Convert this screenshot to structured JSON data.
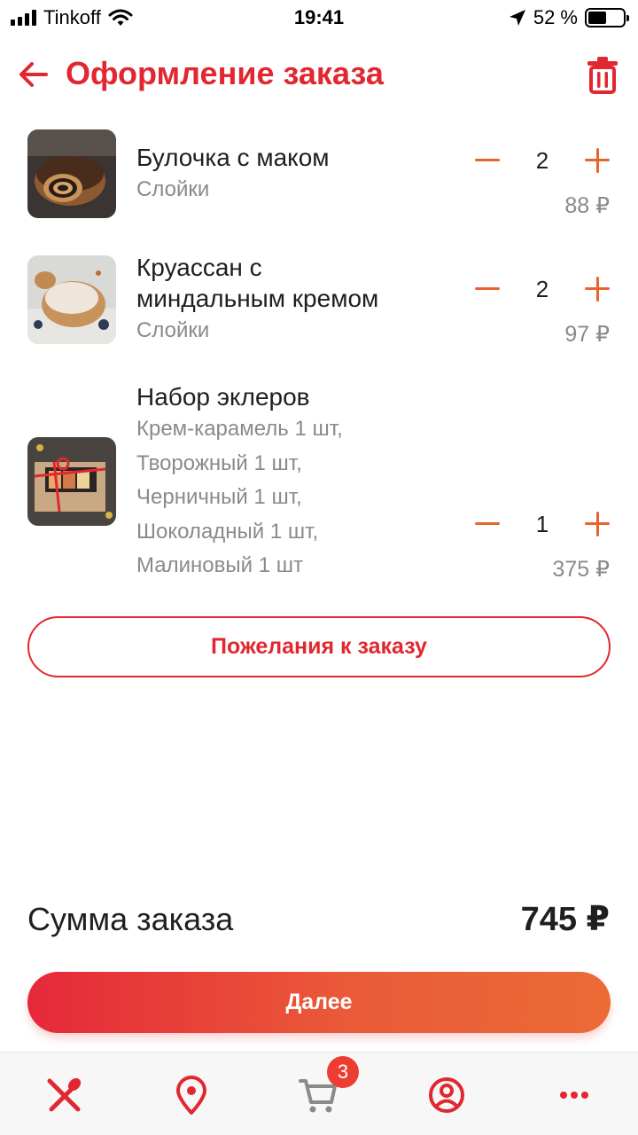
{
  "status_bar": {
    "carrier": "Tinkoff",
    "time": "19:41",
    "battery": "52 %",
    "battery_level": 0.52
  },
  "header": {
    "title": "Оформление заказа",
    "back_icon": "arrow-left-icon",
    "trash_icon": "trash-icon"
  },
  "items": [
    {
      "name": "Булочка с маком",
      "desc": [
        "Слойки"
      ],
      "qty": "2",
      "price": "88 ₽"
    },
    {
      "name_lines": [
        "Круассан с",
        "миндальным кремом"
      ],
      "desc": [
        "Слойки"
      ],
      "qty": "2",
      "price": "97 ₽"
    },
    {
      "name": "Набор эклеров",
      "desc": [
        "Крем-карамель 1 шт,",
        "Творожный 1 шт,",
        "Черничный 1 шт,",
        "Шоколадный 1 шт,",
        "Малиновый 1 шт"
      ],
      "qty": "1",
      "price": "375 ₽"
    }
  ],
  "wishes_button": "Пожелания к заказу",
  "total": {
    "label": "Сумма заказа",
    "value": "745 ₽"
  },
  "next_button": "Далее",
  "tab_bar": {
    "tabs": [
      {
        "icon": "fork-spoon-icon"
      },
      {
        "icon": "location-pin-icon"
      },
      {
        "icon": "cart-icon",
        "badge": "3"
      },
      {
        "icon": "profile-icon"
      },
      {
        "icon": "more-icon"
      }
    ]
  },
  "colors": {
    "accent": "#e1272f",
    "orange": "#e8642b",
    "muted": "#8a8a8a"
  }
}
